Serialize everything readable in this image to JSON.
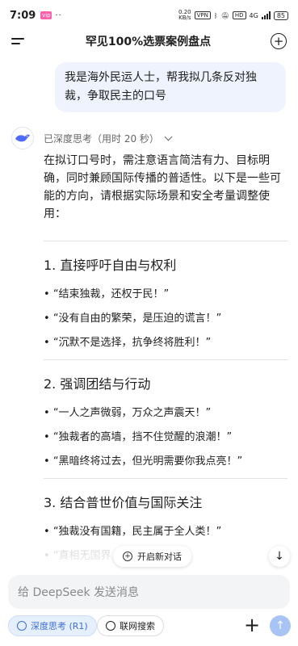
{
  "status_bar": {
    "time": "7:09",
    "dots": "··",
    "speed_value": "0.20",
    "speed_unit": "KB/s",
    "vpn": "VPN",
    "hd": "HD",
    "network": "4G",
    "battery": "85"
  },
  "header": {
    "title": "罕见100%选票案例盘点"
  },
  "user_message": "我是海外民运人士，帮我拟几条反对独裁，争取民主的口号",
  "assistant": {
    "thinking_label": "已深度思考（用时 20 秒）",
    "intro": "在拟订口号时，需注意语言简洁有力、目标明确，同时兼顾国际传播的普适性。以下是一些可能的方向，请根据实际场景和安全考量调整使用：",
    "sections": [
      {
        "title": "1. 直接呼吁自由与权利",
        "items": [
          "“结束独裁，还权于民！”",
          "“没有自由的繁荣，是压迫的谎言！”",
          "“沉默不是选择，抗争终将胜利！”"
        ]
      },
      {
        "title": "2. 强调团结与行动",
        "items": [
          "“一人之声微弱，万众之声震天！”",
          "“独裁者的高墙，挡不住觉醒的浪潮！”",
          "“黑暗终将过去，但光明需要你我点亮！”"
        ]
      },
      {
        "title": "3. 结合普世价值与国际关注",
        "items": [
          "“独裁没有国籍，民主属于全人类！”",
          "“真相无国界，自由……”"
        ]
      }
    ]
  },
  "floating": {
    "new_dialog_label": "开启新对话"
  },
  "composer": {
    "placeholder": "给 DeepSeek 发送消息",
    "deep_think_label": "深度思考 (R1)",
    "web_search_label": "联网搜索"
  }
}
